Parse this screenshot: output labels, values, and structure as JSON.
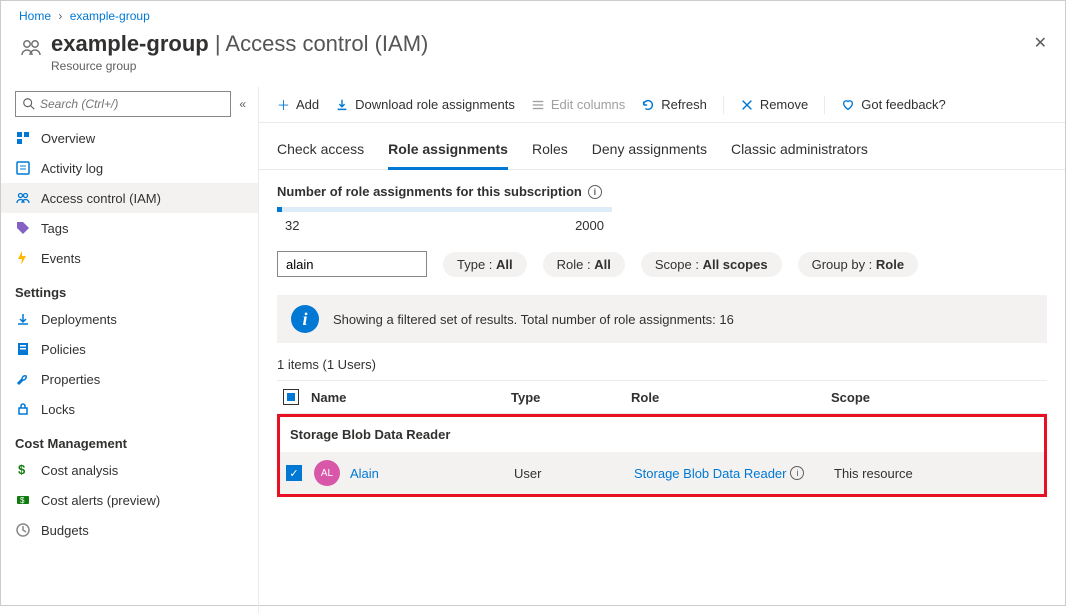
{
  "breadcrumb": {
    "home": "Home",
    "current": "example-group"
  },
  "header": {
    "title": "example-group",
    "suffix": " | Access control (IAM)",
    "subtitle": "Resource group"
  },
  "sidebar": {
    "search_placeholder": "Search (Ctrl+/)",
    "items_top": [
      {
        "icon": "overview",
        "label": "Overview"
      },
      {
        "icon": "activity",
        "label": "Activity log"
      },
      {
        "icon": "iam",
        "label": "Access control (IAM)",
        "active": true
      },
      {
        "icon": "tags",
        "label": "Tags"
      },
      {
        "icon": "events",
        "label": "Events"
      }
    ],
    "section_settings": "Settings",
    "items_settings": [
      {
        "icon": "deploy",
        "label": "Deployments"
      },
      {
        "icon": "policies",
        "label": "Policies"
      },
      {
        "icon": "props",
        "label": "Properties"
      },
      {
        "icon": "locks",
        "label": "Locks"
      }
    ],
    "section_cost": "Cost Management",
    "items_cost": [
      {
        "icon": "costa",
        "label": "Cost analysis"
      },
      {
        "icon": "alerts",
        "label": "Cost alerts (preview)"
      },
      {
        "icon": "budgets",
        "label": "Budgets"
      }
    ]
  },
  "toolbar": {
    "add": "Add",
    "download": "Download role assignments",
    "editcols": "Edit columns",
    "refresh": "Refresh",
    "remove": "Remove",
    "feedback": "Got feedback?"
  },
  "tabs": {
    "check": "Check access",
    "roleassign": "Role assignments",
    "roles": "Roles",
    "deny": "Deny assignments",
    "classic": "Classic administrators"
  },
  "counter": {
    "label": "Number of role assignments for this subscription",
    "low": "32",
    "high": "2000"
  },
  "filters": {
    "search_value": "alain",
    "type_label": "Type : ",
    "type_value": "All",
    "role_label": "Role : ",
    "role_value": "All",
    "scope_label": "Scope : ",
    "scope_value": "All scopes",
    "group_label": "Group by : ",
    "group_value": "Role"
  },
  "info_bar": "Showing a filtered set of results. Total number of role assignments: 16",
  "summary": "1 items (1 Users)",
  "table": {
    "headers": {
      "name": "Name",
      "type": "Type",
      "role": "Role",
      "scope": "Scope"
    },
    "group_header": "Storage Blob Data Reader",
    "rows": [
      {
        "initials": "AL",
        "name": "Alain",
        "type": "User",
        "role": "Storage Blob Data Reader",
        "scope": "This resource"
      }
    ]
  }
}
